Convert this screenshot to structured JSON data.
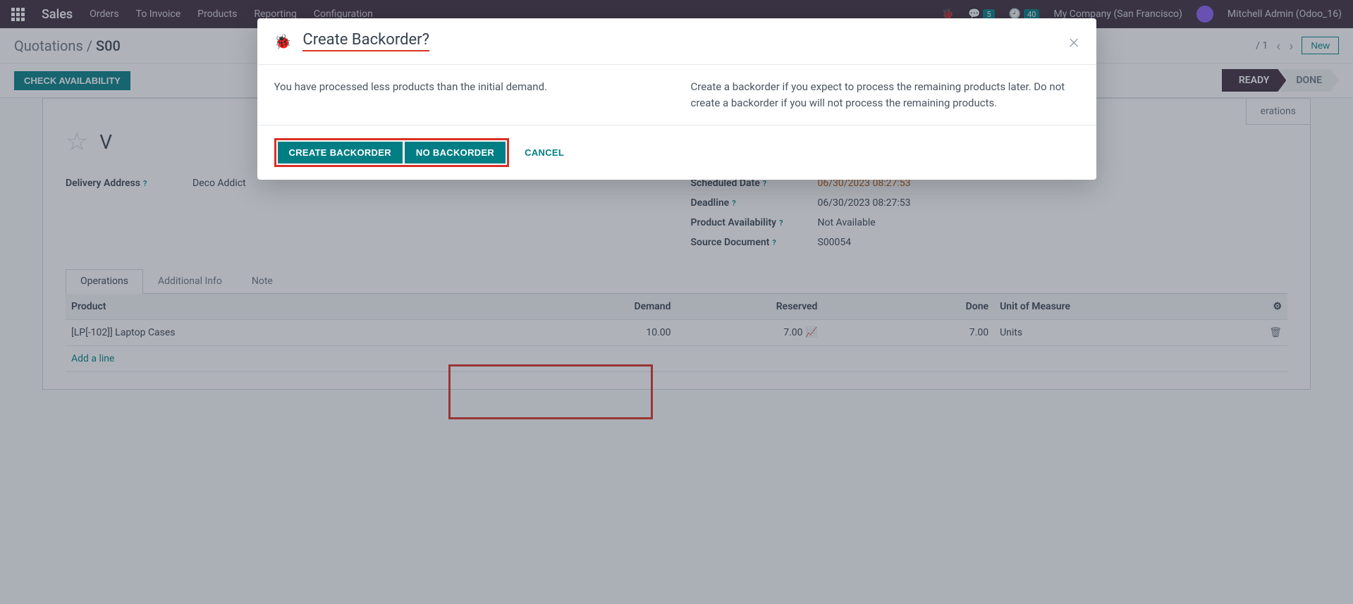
{
  "nav": {
    "app": "Sales",
    "menus": [
      "Orders",
      "To Invoice",
      "Products",
      "Reporting",
      "Configuration"
    ],
    "messages_badge": "5",
    "activities_badge": "40",
    "company": "My Company (San Francisco)",
    "user": "Mitchell Admin (Odoo_16)"
  },
  "subheader": {
    "bc1": "Quotations",
    "bc2": "S00",
    "pager": "/ 1",
    "new_btn": "New"
  },
  "toolbar": {
    "check_availability": "CHECK AVAILABILITY",
    "status_ready": "READY",
    "status_done": "DONE"
  },
  "sheet": {
    "smart_button": "erations",
    "title_placeholder": "V",
    "fields": {
      "delivery_address_label": "Delivery Address",
      "delivery_address_value": "Deco Addict",
      "scheduled_date_label": "Scheduled Date",
      "scheduled_date_value": "06/30/2023 08:27:53",
      "deadline_label": "Deadline",
      "deadline_value": "06/30/2023 08:27:53",
      "product_availability_label": "Product Availability",
      "product_availability_value": "Not Available",
      "source_document_label": "Source Document",
      "source_document_value": "S00054"
    },
    "tabs": [
      "Operations",
      "Additional Info",
      "Note"
    ],
    "grid": {
      "cols": {
        "product": "Product",
        "demand": "Demand",
        "reserved": "Reserved",
        "done": "Done",
        "uom": "Unit of Measure"
      },
      "row": {
        "product": "[LP[-102]] Laptop Cases",
        "demand": "10.00",
        "reserved": "7.00",
        "done": "7.00",
        "uom": "Units"
      },
      "add_line": "Add a line"
    }
  },
  "modal": {
    "title": "Create Backorder?",
    "body_left": "You have processed less products than the initial demand.",
    "body_right": "Create a backorder if you expect to process the remaining products later. Do not create a backorder if you will not process the remaining products.",
    "btn_create": "CREATE BACKORDER",
    "btn_no": "NO BACKORDER",
    "btn_cancel": "CANCEL"
  }
}
